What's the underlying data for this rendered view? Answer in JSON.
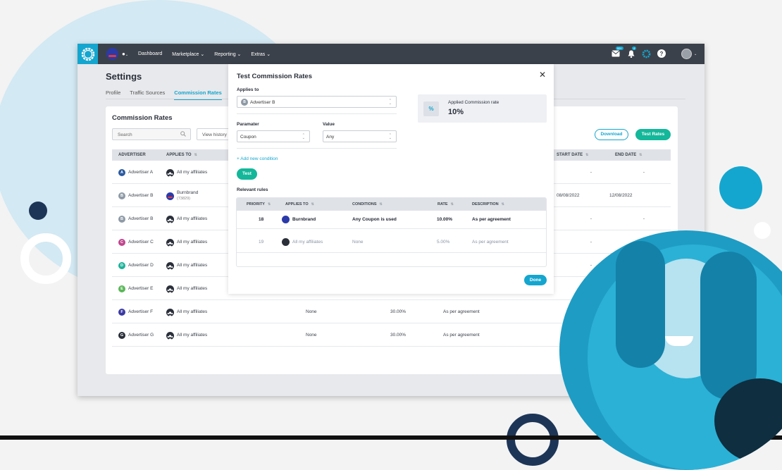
{
  "colors": {
    "accent": "#14a6cf",
    "green": "#14b79a",
    "navbar": "#3b414a"
  },
  "nav": {
    "items": [
      "Dashboard",
      "Marketplace",
      "Reporting",
      "Extras"
    ],
    "mail_badge": "99+",
    "bell_badge": "4"
  },
  "page": {
    "title": "Settings",
    "tabs": [
      "Profile",
      "Traffic Sources",
      "Commission Rates"
    ]
  },
  "card": {
    "title": "Commission Rates",
    "search_placeholder": "Search",
    "view_history": "View history",
    "download": "Download",
    "test_rates": "Test Rates"
  },
  "table": {
    "headers": {
      "advertiser": "ADVERTISER",
      "applies_to": "APPLIES TO",
      "start": "START DATE",
      "end": "END DATE"
    },
    "rows": [
      {
        "advertiser": "Advertiser A",
        "initial": "A",
        "applies": "All my affiliates",
        "sub": "",
        "conditions": "",
        "rate": "",
        "description": "",
        "start": "-",
        "end": "-"
      },
      {
        "advertiser": "Advertiser B",
        "initial": "B",
        "applies": "Burnbrand",
        "sub": "(73829)",
        "conditions": "",
        "rate": "",
        "description": "",
        "start": "08/08/2022",
        "end": "12/08/2022"
      },
      {
        "advertiser": "Advertiser B",
        "initial": "B",
        "applies": "All my affiliates",
        "sub": "",
        "conditions": "",
        "rate": "",
        "description": "",
        "start": "-",
        "end": "-"
      },
      {
        "advertiser": "Advertiser C",
        "initial": "C",
        "applies": "All my affiliates",
        "sub": "",
        "conditions": "",
        "rate": "",
        "description": "",
        "start": "-",
        "end": ""
      },
      {
        "advertiser": "Advertiser D",
        "initial": "D",
        "applies": "All my affiliates",
        "sub": "",
        "conditions": "",
        "rate": "",
        "description": "",
        "start": "-",
        "end": ""
      },
      {
        "advertiser": "Advertiser E",
        "initial": "E",
        "applies": "All my affiliates",
        "sub": "",
        "conditions": "",
        "rate": "",
        "description": "",
        "start": "",
        "end": ""
      },
      {
        "advertiser": "Advertiser F",
        "initial": "F",
        "applies": "All my affiliates",
        "sub": "",
        "conditions": "None",
        "rate": "30.00%",
        "description": "As per agreement",
        "start": "",
        "end": ""
      },
      {
        "advertiser": "Advertiser G",
        "initial": "G",
        "applies": "All my affiliates",
        "sub": "",
        "conditions": "None",
        "rate": "30.00%",
        "description": "As per agreement",
        "start": "",
        "end": ""
      }
    ]
  },
  "modal": {
    "title": "Test Commission Rates",
    "applies_to_label": "Applies to",
    "applies_to_value": "Advertiser B",
    "parameter_label": "Paramater",
    "parameter_value": "Coupon",
    "value_label": "Value",
    "value_value": "Any",
    "add_condition": "+ Add new condition",
    "test": "Test",
    "result_label": "Applied Commission rate",
    "result_value": "10%",
    "result_icon": "%",
    "rules_title": "Relevant rules",
    "rules_headers": [
      "PRIORITY",
      "APPLIES TO",
      "CONDITIONS",
      "RATE",
      "DESCRIPTION"
    ],
    "rules": [
      {
        "priority": "18",
        "applies": "Burnbrand",
        "conditions": "Any Coupon is used",
        "rate": "10.00%",
        "description": "As per agreement"
      },
      {
        "priority": "19",
        "applies": "All my affiliates",
        "conditions": "None",
        "rate": "5.00%",
        "description": "As per agreement"
      }
    ],
    "done": "Done"
  }
}
